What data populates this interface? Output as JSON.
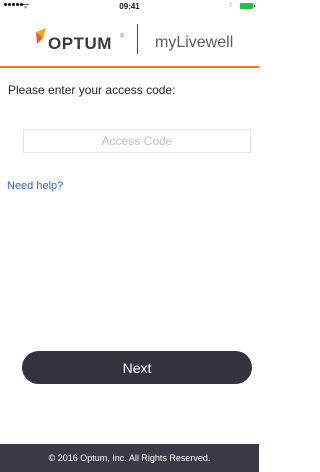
{
  "status_bar": {
    "wifi": "ᯤ",
    "time": "09:41",
    "moon": "☾"
  },
  "header": {
    "logo_text": "OPTUM",
    "logo_reg": "®",
    "brand_name": "myLivewell",
    "colors": {
      "accent": "#f07a22",
      "logo_gold": "#f5a623",
      "logo_orange": "#e8601c"
    }
  },
  "main": {
    "prompt": "Please enter your access code:",
    "access_code": {
      "value": "",
      "placeholder": "Access Code"
    },
    "help_link": "Need help?",
    "next_button": "Next"
  },
  "footer": {
    "copyright": "© 2016 Optum, Inc. All Rights Reserved."
  }
}
